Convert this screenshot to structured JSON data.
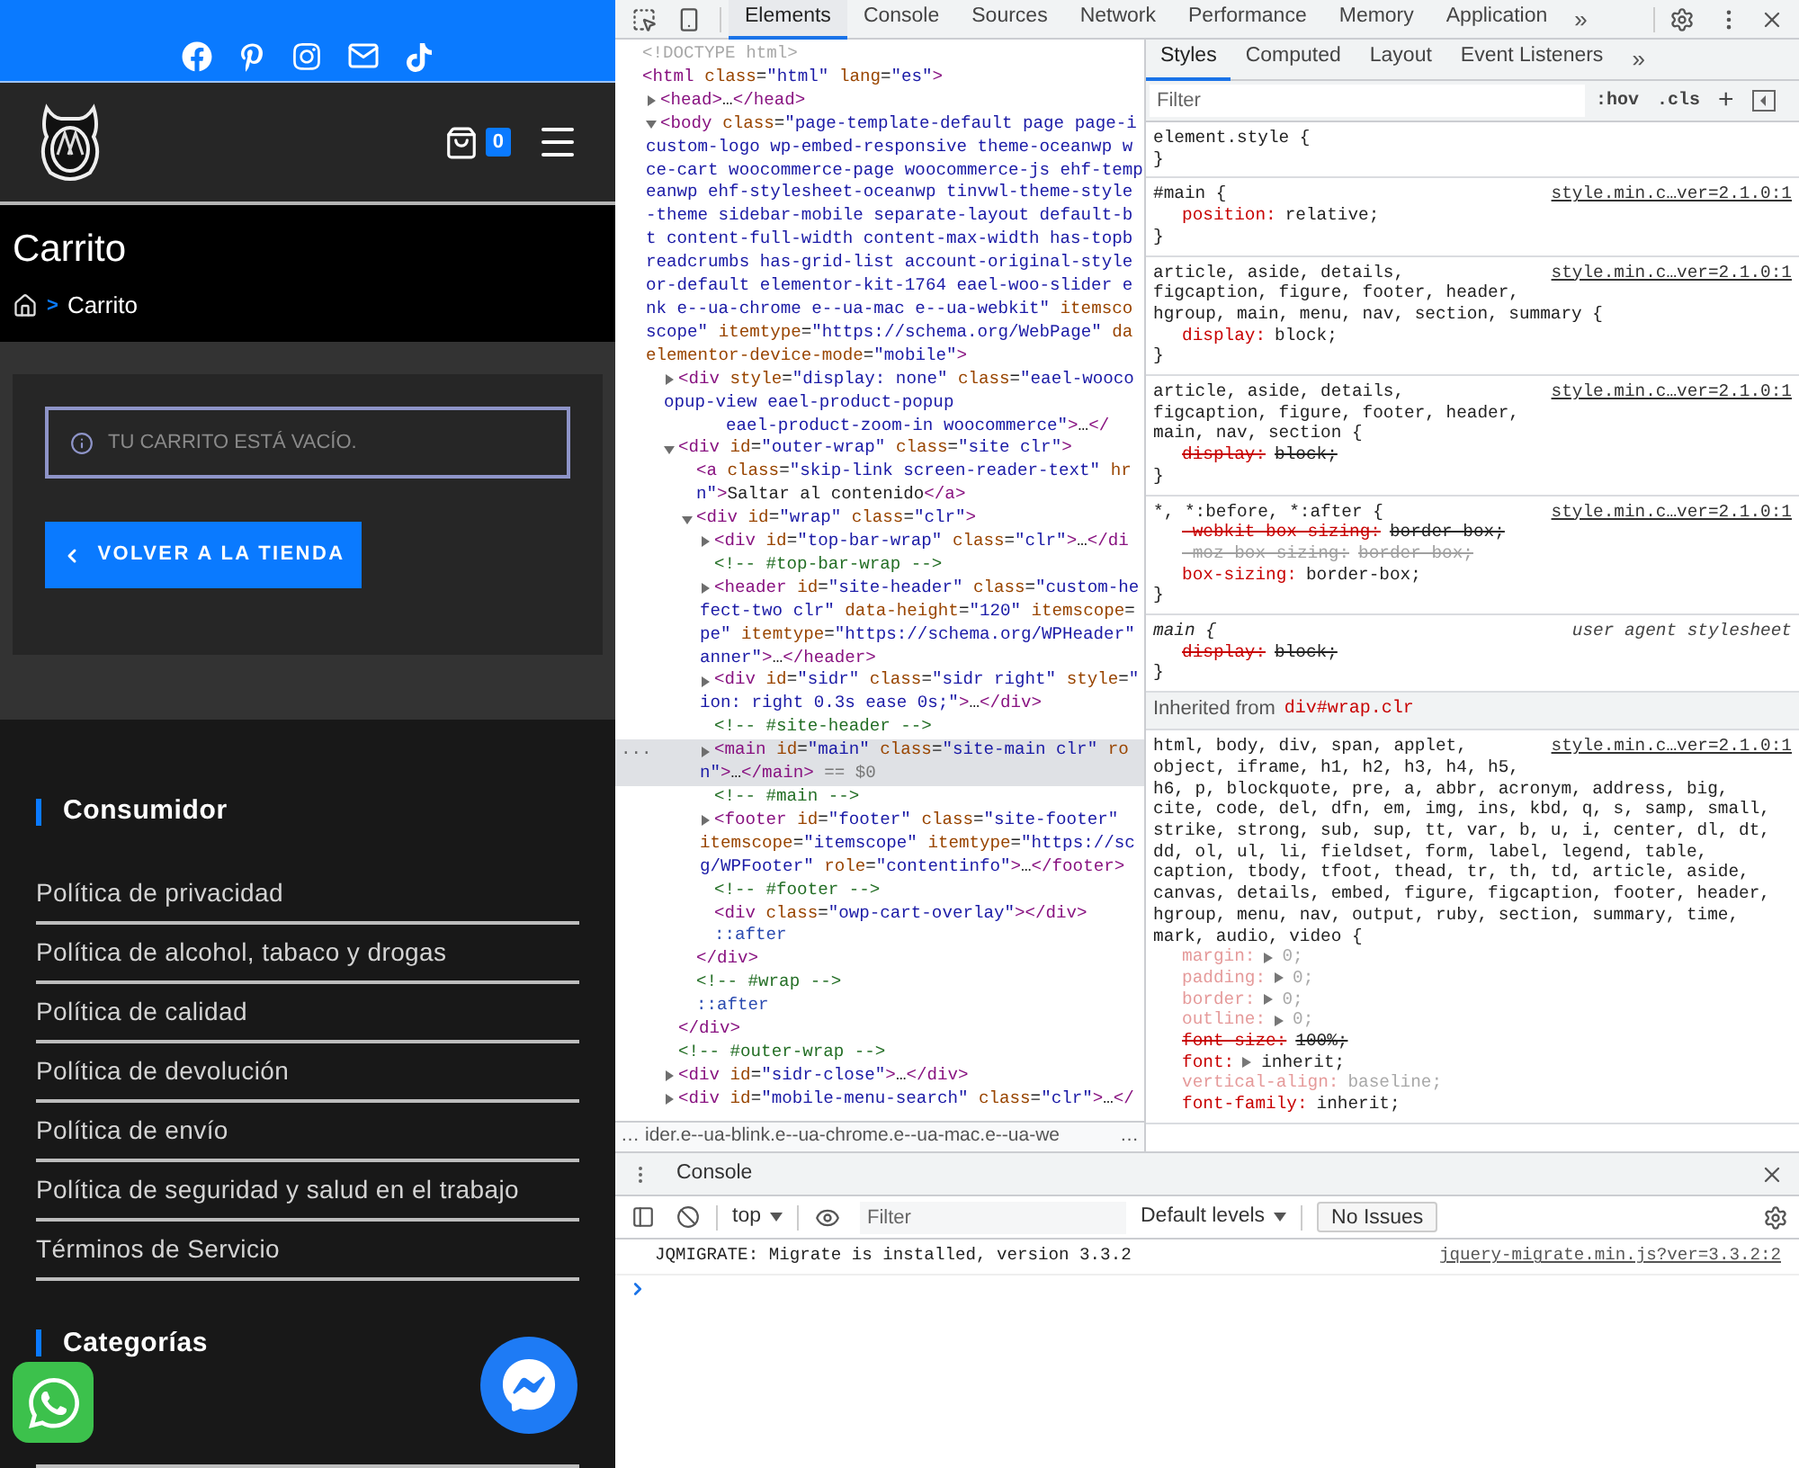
{
  "site": {
    "cart_count": "0",
    "page_title": "Carrito",
    "breadcrumb": {
      "separator": ">",
      "current": "Carrito"
    },
    "notice": "TU CARRITO ESTÁ VACÍO.",
    "return_button": "VOLVER A LA TIENDA",
    "footer_sections": [
      {
        "title": "Consumidor",
        "links": [
          "Política de privacidad",
          "Política de alcohol, tabaco y drogas",
          "Política de calidad",
          "Política de devolución",
          "Política de envío",
          "Política de seguridad y salud en el trabajo",
          "Términos de Servicio"
        ]
      },
      {
        "title": "Categorías"
      }
    ]
  },
  "devtools": {
    "tabs": [
      {
        "label": "Elements",
        "selected": true
      },
      {
        "label": "Console",
        "selected": false
      },
      {
        "label": "Sources",
        "selected": false
      },
      {
        "label": "Network",
        "selected": false
      },
      {
        "label": "Performance",
        "selected": false
      },
      {
        "label": "Memory",
        "selected": false
      },
      {
        "label": "Application",
        "selected": false
      }
    ],
    "more_tabs": "»",
    "elements": {
      "gutter": "...",
      "nodes": [
        {
          "kind": "doctype",
          "selected": false,
          "lines": [
            "<!DOCTYPE html>"
          ]
        },
        {
          "kind": "tag",
          "selected": false,
          "lines": [
            "<html class=\"html\" lang=\"es\">"
          ],
          "children": [
            {
              "kind": "expandable",
              "expanded": false,
              "selected": false,
              "lines": [
                "<head>…</head>"
              ]
            },
            {
              "kind": "expandable",
              "expanded": true,
              "selected": false,
              "lines": [
                "<body class=\"page-template-default page page-i",
                "custom-logo wp-embed-responsive theme-oceanwp w",
                "ce-cart woocommerce-page woocommerce-js ehf-temp",
                "eanwp ehf-stylesheet-oceanwp tinvwl-theme-style",
                "-theme sidebar-mobile separate-layout default-b",
                "t content-full-width content-max-width has-topb",
                "readcrumbs has-grid-list account-original-style",
                "or-default elementor-kit-1764 eael-woo-slider e",
                "nk e--ua-chrome e--ua-mac e--ua-webkit\" itemsco",
                "scope\" itemtype=\"https://schema.org/WebPage\" da",
                "elementor-device-mode=\"mobile\">"
              ],
              "children": [
                {
                  "kind": "expandable",
                  "expanded": false,
                  "selected": false,
                  "lines": [
                    "<div style=\"display: none\" class=\"eael-wooco",
                    "opup-view eael-product-popup",
                    "      eael-product-zoom-in woocommerce\">…</"
                  ]
                },
                {
                  "kind": "expandable",
                  "expanded": true,
                  "selected": false,
                  "lines": [
                    "<div id=\"outer-wrap\" class=\"site clr\">"
                  ],
                  "closing": "</div>",
                  "children": [
                    {
                      "kind": "tag",
                      "selected": false,
                      "lines": [
                        "<a class=\"skip-link screen-reader-text\" hr",
                        "n\">Saltar al contenido</a>"
                      ]
                    },
                    {
                      "kind": "expandable",
                      "expanded": true,
                      "selected": false,
                      "lines": [
                        "<div id=\"wrap\" class=\"clr\">"
                      ],
                      "closing": "</div>",
                      "children": [
                        {
                          "kind": "expandable",
                          "expanded": false,
                          "selected": false,
                          "lines": [
                            "<div id=\"top-bar-wrap\" class=\"clr\">…</di"
                          ]
                        },
                        {
                          "kind": "comment",
                          "selected": false,
                          "lines": [
                            "<!-- #top-bar-wrap -->"
                          ]
                        },
                        {
                          "kind": "expandable",
                          "expanded": false,
                          "selected": false,
                          "lines": [
                            "<header id=\"site-header\" class=\"custom-he",
                            "fect-two clr\" data-height=\"120\" itemscope=",
                            "pe\" itemtype=\"https://schema.org/WPHeader\"",
                            "anner\">…</header>"
                          ]
                        },
                        {
                          "kind": "expandable",
                          "expanded": false,
                          "selected": false,
                          "lines": [
                            "<div id=\"sidr\" class=\"sidr right\" style=\"",
                            "ion: right 0.3s ease 0s;\">…</div>"
                          ]
                        },
                        {
                          "kind": "comment",
                          "selected": false,
                          "lines": [
                            "<!-- #site-header -->"
                          ]
                        },
                        {
                          "kind": "expandable",
                          "expanded": false,
                          "selected": true,
                          "lines": [
                            "<main id=\"main\" class=\"site-main clr\" ro",
                            "n\">…</main>"
                          ],
                          "marker": "== $0"
                        },
                        {
                          "kind": "comment",
                          "selected": false,
                          "lines": [
                            "<!-- #main -->"
                          ]
                        },
                        {
                          "kind": "expandable",
                          "expanded": false,
                          "selected": false,
                          "lines": [
                            "<footer id=\"footer\" class=\"site-footer\"",
                            "itemscope=\"itemscope\" itemtype=\"https://sc",
                            "g/WPFooter\" role=\"contentinfo\">…</footer>"
                          ]
                        },
                        {
                          "kind": "comment",
                          "selected": false,
                          "lines": [
                            "<!-- #footer -->"
                          ]
                        },
                        {
                          "kind": "tag",
                          "selected": false,
                          "lines": [
                            "<div class=\"owp-cart-overlay\"></div>"
                          ]
                        },
                        {
                          "kind": "pseudo",
                          "selected": false,
                          "lines": [
                            "::after"
                          ]
                        }
                      ]
                    },
                    {
                      "kind": "comment",
                      "selected": false,
                      "lines": [
                        "<!-- #wrap -->"
                      ]
                    },
                    {
                      "kind": "pseudo",
                      "selected": false,
                      "lines": [
                        "::after"
                      ]
                    }
                  ]
                },
                {
                  "kind": "comment",
                  "selected": false,
                  "lines": [
                    "<!-- #outer-wrap -->"
                  ]
                },
                {
                  "kind": "expandable",
                  "expanded": false,
                  "selected": false,
                  "lines": [
                    "<div id=\"sidr-close\">…</div>"
                  ]
                },
                {
                  "kind": "expandable",
                  "expanded": false,
                  "selected": false,
                  "lines": [
                    "<div id=\"mobile-menu-search\" class=\"clr\">…</"
                  ]
                }
              ]
            }
          ]
        }
      ]
    },
    "breadcrumb": {
      "more_before": "…",
      "path": "ider.e--ua-blink.e--ua-chrome.e--ua-mac.e--ua-we",
      "more_after": "…"
    },
    "sidebar_tabs": [
      {
        "label": "Styles",
        "selected": true
      },
      {
        "label": "Computed",
        "selected": false
      },
      {
        "label": "Layout",
        "selected": false
      },
      {
        "label": "Event Listeners",
        "selected": false
      }
    ],
    "more_sidebar_tabs": "»",
    "styles_filter": {
      "placeholder": "Filter",
      "hov": ":hov",
      "cls": ".cls",
      "add": "+"
    },
    "rules": [
      {
        "selector_lines": [
          "element.style {"
        ],
        "user_agent": false,
        "end": "}"
      },
      {
        "selector_lines": [
          "#main {"
        ],
        "source": "style.min.c…ver=2.1.0:1",
        "user_agent": false,
        "end": "}",
        "properties": [
          {
            "name": "position:",
            "value": "relative;",
            "overridden": false,
            "dimmed": false,
            "shorthand": false
          }
        ]
      },
      {
        "selector_lines": [
          "article, aside, details,",
          "figcaption, figure, footer, header,",
          "hgroup, main, menu, nav, section, summary {"
        ],
        "source": "style.min.c…ver=2.1.0:1",
        "user_agent": false,
        "end": "}",
        "properties": [
          {
            "name": "display:",
            "value": "block;",
            "overridden": false,
            "dimmed": false,
            "shorthand": false
          }
        ]
      },
      {
        "selector_lines": [
          "article, aside, details,",
          "figcaption, figure, footer, header,",
          "main, nav, section {"
        ],
        "source": "style.min.c…ver=2.1.0:1",
        "user_agent": false,
        "end": "}",
        "properties": [
          {
            "name": "display:",
            "value": "block;",
            "overridden": true,
            "dimmed": false,
            "shorthand": false
          }
        ]
      },
      {
        "selector_lines": [
          "*, *:before, *:after {"
        ],
        "source": "style.min.c…ver=2.1.0:1",
        "user_agent": false,
        "end": "}",
        "properties": [
          {
            "name": "-webkit-box-sizing:",
            "value": "border-box;",
            "overridden": true,
            "dimmed": false,
            "shorthand": false
          },
          {
            "name": "-moz-box-sizing:",
            "value": "border-box;",
            "overridden": true,
            "dimmed": true,
            "shorthand": false
          },
          {
            "name": "box-sizing:",
            "value": "border-box;",
            "overridden": false,
            "dimmed": false,
            "shorthand": false
          }
        ]
      },
      {
        "selector_lines": [
          "main {"
        ],
        "source": "user agent stylesheet",
        "user_agent": true,
        "end": "}",
        "properties": [
          {
            "name": "display:",
            "value": "block;",
            "overridden": true,
            "dimmed": false,
            "shorthand": false
          }
        ]
      }
    ],
    "inherited": {
      "label": "Inherited from",
      "element": "div#wrap.clr",
      "rules": [
        {
          "selector_lines": [
            "html, body, div, span, applet,",
            "object, iframe, h1, h2, h3, h4, h5,",
            "h6, p, blockquote, pre, a, abbr, acronym, address, big,",
            "cite, code, del, dfn, em, img, ins, kbd, q, s, samp, small,",
            "strike, strong, sub, sup, tt, var, b, u, i, center, dl, dt,",
            "dd, ol, ul, li, fieldset, form, label, legend, table,",
            "caption, tbody, tfoot, thead, tr, th, td, article, aside,",
            "canvas, details, embed, figure, figcaption, footer, header,",
            "hgroup, menu, nav, output, ruby, section, summary, time,",
            "mark, audio, video {"
          ],
          "source": "style.min.c…ver=2.1.0:1",
          "user_agent": false,
          "properties": [
            {
              "name": "margin:",
              "value": "0;",
              "overridden": false,
              "dimmed": true,
              "shorthand": true
            },
            {
              "name": "padding:",
              "value": "0;",
              "overridden": false,
              "dimmed": true,
              "shorthand": true
            },
            {
              "name": "border:",
              "value": "0;",
              "overridden": false,
              "dimmed": true,
              "shorthand": true
            },
            {
              "name": "outline:",
              "value": "0;",
              "overridden": false,
              "dimmed": true,
              "shorthand": true
            },
            {
              "name": "font-size:",
              "value": "100%;",
              "overridden": true,
              "dimmed": false,
              "shorthand": false
            },
            {
              "name": "font:",
              "value": "inherit;",
              "overridden": false,
              "dimmed": false,
              "shorthand": true
            },
            {
              "name": "vertical-align:",
              "value": "baseline;",
              "overridden": false,
              "dimmed": true,
              "shorthand": false
            },
            {
              "name": "font-family:",
              "value": "inherit;",
              "overridden": false,
              "dimmed": false,
              "shorthand": false
            }
          ]
        }
      ]
    },
    "drawer": {
      "tab": "Console",
      "context": "top",
      "filter_placeholder": "Filter",
      "levels": "Default levels",
      "issues": "No Issues",
      "messages": [
        {
          "text": "JQMIGRATE: Migrate is installed, version 3.3.2",
          "source": "jquery-migrate.min.js?ver=3.3.2:2"
        }
      ]
    }
  }
}
